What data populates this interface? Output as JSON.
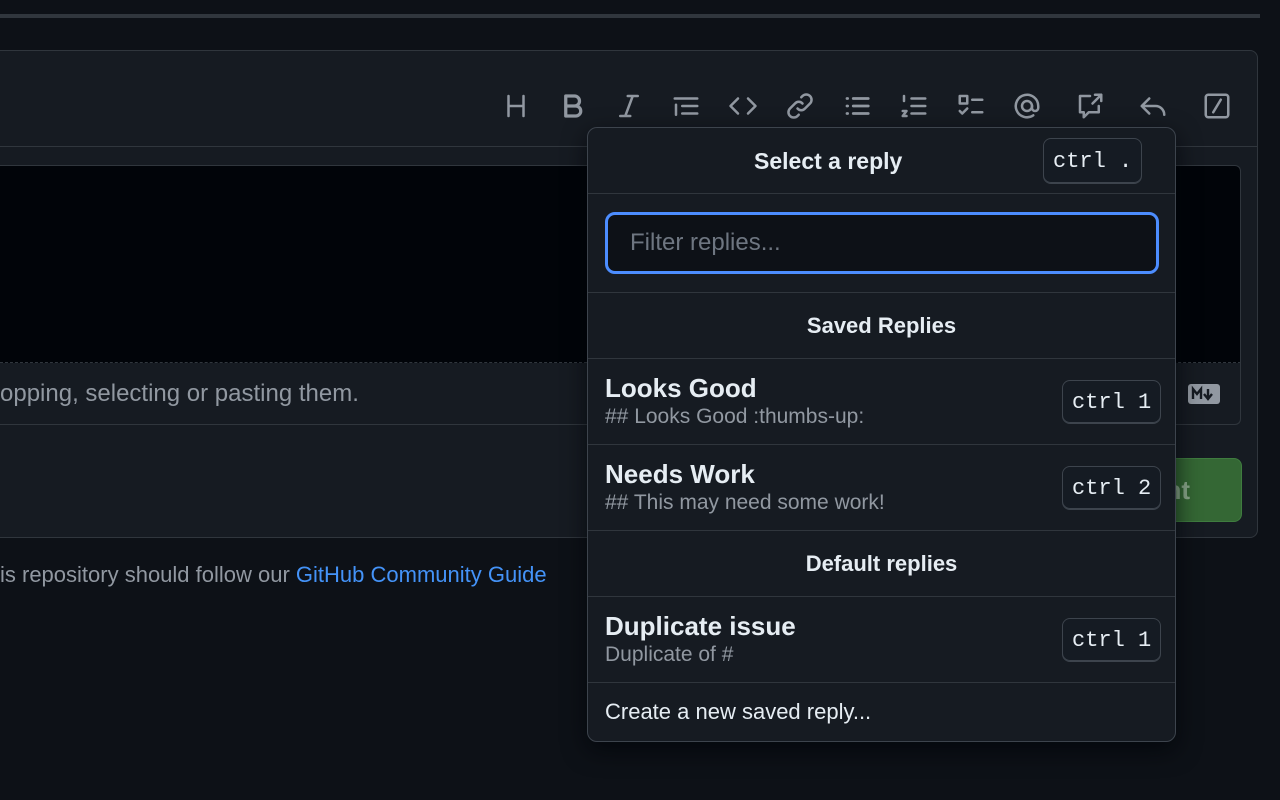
{
  "editor": {
    "hint_text": "opping, selecting or pasting them.",
    "submit_label": "ent",
    "guidelines_prefix": "is repository should follow our ",
    "guidelines_link": "GitHub Community Guide"
  },
  "toolbar": {
    "tools": [
      "heading-icon",
      "bold-icon",
      "italic-icon",
      "quote-icon",
      "code-icon",
      "link-icon",
      "bulleted-list-icon",
      "numbered-list-icon",
      "task-list-icon",
      "mention-icon",
      "reference-icon",
      "saved-reply-icon",
      "slash-command-icon"
    ]
  },
  "reply_menu": {
    "title": "Select a reply",
    "shortcut": "ctrl .",
    "filter_placeholder": "Filter replies...",
    "saved_section_title": "Saved Replies",
    "saved_replies": [
      {
        "title": "Looks Good",
        "body": "## Looks Good :thumbs-up:",
        "shortcut": "ctrl 1"
      },
      {
        "title": "Needs Work",
        "body": "## This may need some work!",
        "shortcut": "ctrl 2"
      }
    ],
    "default_section_title": "Default replies",
    "default_replies": [
      {
        "title": "Duplicate issue",
        "body": "Duplicate of #",
        "shortcut": "ctrl 1"
      }
    ],
    "create_label": "Create a new saved reply..."
  },
  "colors": {
    "background": "#0d1117",
    "accent_focus": "#4c8dff",
    "link": "#4493f8",
    "submit_green": "#346734"
  }
}
